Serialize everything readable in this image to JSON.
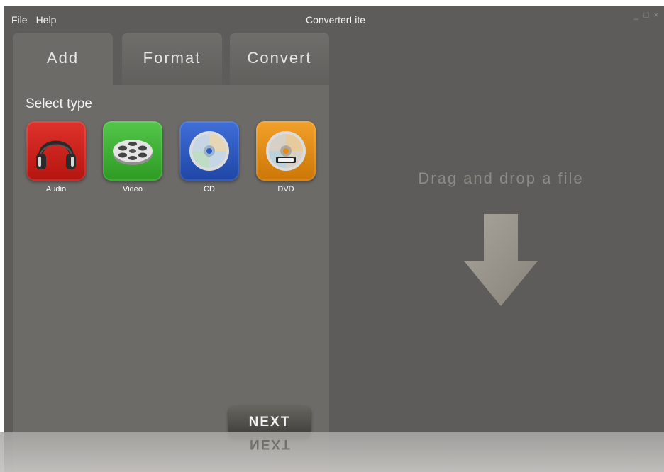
{
  "window": {
    "title": "ConverterLite",
    "controls": [
      "_",
      "□",
      "×"
    ]
  },
  "menu": {
    "file": "File",
    "help": "Help"
  },
  "tabs": [
    {
      "label": "Add",
      "active": true
    },
    {
      "label": "Format",
      "active": false
    },
    {
      "label": "Convert",
      "active": false
    }
  ],
  "add_panel": {
    "heading": "Select type",
    "types": [
      {
        "label": "Audio",
        "icon": "headphones-icon",
        "color": "#c91f1a"
      },
      {
        "label": "Video",
        "icon": "film-reel-icon",
        "color": "#3fb035"
      },
      {
        "label": "CD",
        "icon": "cd-icon",
        "color": "#2f5cc4"
      },
      {
        "label": "DVD",
        "icon": "dvd-icon",
        "color": "#e08b16"
      }
    ],
    "next_label": "NEXT"
  },
  "drop_zone": {
    "text": "Drag and drop a file",
    "icon": "down-arrow-icon"
  }
}
